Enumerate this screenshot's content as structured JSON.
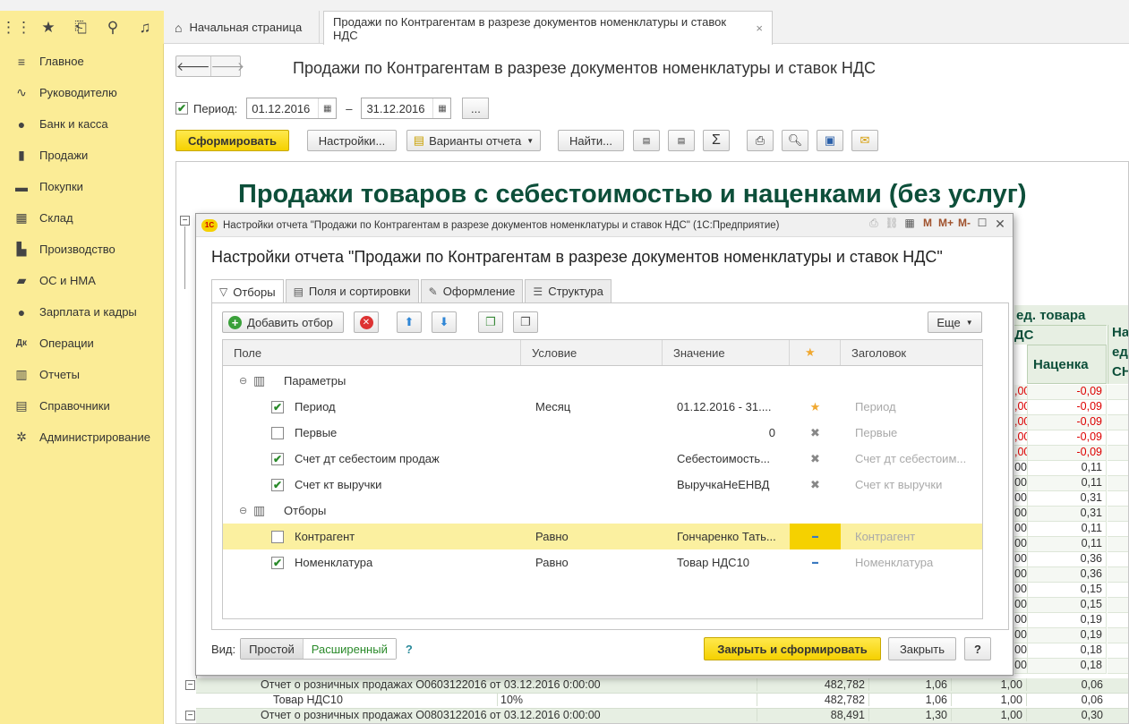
{
  "topbar": {
    "icons": [
      "apps-grid-icon",
      "star-icon",
      "history-icon",
      "search-icon",
      "bell-icon"
    ],
    "tabs": [
      {
        "label": "Начальная страница"
      },
      {
        "label": "Продажи по Контрагентам в разрезе документов номенклатуры и ставок НДС",
        "close": "×"
      }
    ]
  },
  "sidebar": {
    "items": [
      {
        "label": "Главное",
        "icon": "menu-icon",
        "glyph": "≡"
      },
      {
        "label": "Руководителю",
        "icon": "chart-line-icon",
        "glyph": "∿"
      },
      {
        "label": "Банк и касса",
        "icon": "coin-icon",
        "glyph": "●"
      },
      {
        "label": "Продажи",
        "icon": "bag-icon",
        "glyph": "▮"
      },
      {
        "label": "Покупки",
        "icon": "cart-icon",
        "glyph": "▬"
      },
      {
        "label": "Склад",
        "icon": "warehouse-icon",
        "glyph": "▦"
      },
      {
        "label": "Производство",
        "icon": "factory-icon",
        "glyph": "▙"
      },
      {
        "label": "ОС и НМА",
        "icon": "truck-icon",
        "glyph": "▰"
      },
      {
        "label": "Зарплата и кадры",
        "icon": "person-icon",
        "glyph": "●"
      },
      {
        "label": "Операции",
        "icon": "dt-kt-icon",
        "glyph": "Дк"
      },
      {
        "label": "Отчеты",
        "icon": "bar-chart-icon",
        "glyph": "▥"
      },
      {
        "label": "Справочники",
        "icon": "book-icon",
        "glyph": "▤"
      },
      {
        "label": "Администрирование",
        "icon": "gear-icon",
        "glyph": "✲"
      }
    ]
  },
  "main": {
    "title": "Продажи по Контрагентам в разрезе документов номенклатуры и ставок НДС",
    "period_label": "Период:",
    "date_from": "01.12.2016",
    "dash": "–",
    "date_to": "31.12.2016",
    "ellipsis": "...",
    "generate": "Сформировать",
    "settings": "Настройки...",
    "variants": "Варианты отчета",
    "find": "Найти...",
    "report_title": "Продажи товаров с себестоимостью и наценками (без услуг)"
  },
  "report_bg": {
    "hdr1": "ед. товара",
    "hdr2": "ДС",
    "hdr3": "Наценка",
    "hdr4a": "На",
    "hdr4b": "ед",
    "hdr4c": "СН",
    "markups": [
      "-0,09",
      "-0,09",
      "-0,09",
      "-0,09",
      "-0,09",
      "0,11",
      "0,11",
      "0,31",
      "0,31",
      "0,11",
      "0,11",
      "0,36",
      "0,36",
      "0,15",
      "0,15",
      "0,19",
      "0,19",
      "0,18",
      "0,18"
    ],
    "left_vals": [
      ",00",
      ",00",
      ",00",
      ",00",
      ",00",
      "00",
      "00",
      "00",
      "00",
      "00",
      "00",
      "00",
      "00",
      "00",
      "00",
      "00",
      "00",
      "00",
      "00"
    ],
    "bottom_rows": [
      {
        "name": "Отчет о розничных продажах О0603122016 от 03.12.2016 0:00:00",
        "rate": "",
        "sum": "482,782",
        "a": "1,06",
        "b": "1,00",
        "c": "0,06"
      },
      {
        "name": "Товар НДС10",
        "rate": "10%",
        "sum": "482,782",
        "a": "1,06",
        "b": "1,00",
        "c": "0,06"
      },
      {
        "name": "Отчет о розничных продажах О0803122016 от 03.12.2016 0:00:00",
        "rate": "",
        "sum": "88,491",
        "a": "1,30",
        "b": "1,00",
        "c": "0,30"
      }
    ]
  },
  "dialog": {
    "window_title": "Настройки отчета \"Продажи по Контрагентам в разрезе документов номенклатуры и ставок НДС\"  (1С:Предприятие)",
    "logo": "1С",
    "ctrls": [
      "M",
      "M+",
      "M-"
    ],
    "heading": "Настройки отчета \"Продажи по Контрагентам в разрезе документов номенклатуры и ставок НДС\"",
    "tabs": [
      "Отборы",
      "Поля и сортировки",
      "Оформление",
      "Структура"
    ],
    "add_filter": "Добавить отбор",
    "more": "Еще",
    "columns": [
      "Поле",
      "Условие",
      "Значение",
      "★",
      "Заголовок"
    ],
    "groups": [
      {
        "label": "Параметры",
        "rows": [
          {
            "checked": true,
            "field": "Период",
            "cond": "Месяц",
            "value": "01.12.2016 - 31....",
            "mark": "★",
            "title": "Период"
          },
          {
            "checked": false,
            "field": "Первые",
            "cond": "",
            "value": "0",
            "mark": "✖",
            "title": "Первые"
          },
          {
            "checked": true,
            "field": "Счет дт себестоим продаж",
            "cond": "",
            "value": "Себестоимость...",
            "mark": "✖",
            "title": "Счет дт себестоим..."
          },
          {
            "checked": true,
            "field": "Счет кт выручки",
            "cond": "",
            "value": "ВыручкаНеЕНВД",
            "mark": "✖",
            "title": "Счет кт выручки"
          }
        ]
      },
      {
        "label": "Отборы",
        "rows": [
          {
            "checked": false,
            "field": "Контрагент",
            "cond": "Равно",
            "value": "Гончаренко Тать...",
            "mark": "▬",
            "title": "Контрагент"
          },
          {
            "checked": true,
            "field": "Номенклатура",
            "cond": "Равно",
            "value": "Товар НДС10",
            "mark": "▬",
            "title": "Номенклатура"
          }
        ]
      }
    ],
    "view_label": "Вид:",
    "view_simple": "Простой",
    "view_extended": "Расширенный",
    "help_q": "?",
    "close_generate": "Закрыть и сформировать",
    "close": "Закрыть",
    "help": "?"
  }
}
